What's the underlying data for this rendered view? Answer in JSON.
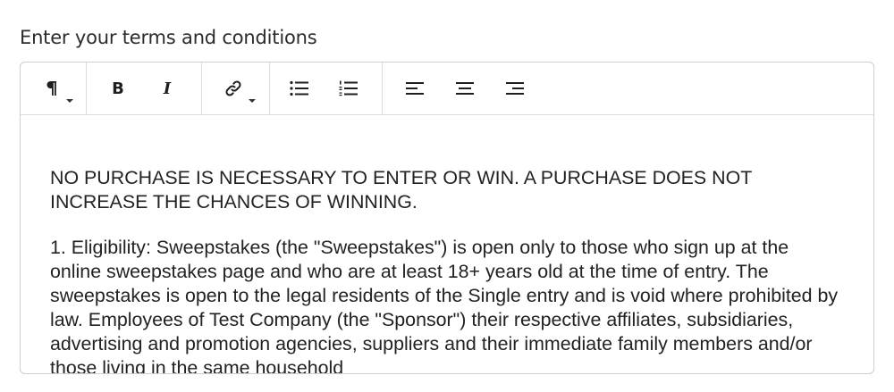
{
  "field": {
    "label": "Enter your terms and conditions"
  },
  "toolbar": {
    "paragraph_icon": "paragraph-icon",
    "bold_label": "B",
    "italic_label": "I",
    "link_icon": "link-icon",
    "bullet_list_icon": "bullet-list-icon",
    "numbered_list_icon": "numbered-list-icon",
    "align_left_icon": "align-left-icon",
    "align_center_icon": "align-center-icon",
    "align_right_icon": "align-right-icon"
  },
  "content": {
    "paragraphs": [
      "NO PURCHASE IS NECESSARY TO ENTER OR WIN. A PURCHASE DOES NOT INCREASE THE CHANCES OF WINNING.",
      "1. Eligibility: Sweepstakes (the \"Sweepstakes\") is open only to those who sign up at the online sweepstakes page and who are at least 18+ years old at the time of entry. The sweepstakes is open to the legal residents of the Single entry and is void where prohibited by law. Employees of Test Company (the \"Sponsor\") their respective affiliates, subsidiaries, advertising and promotion agencies, suppliers and their immediate family members and/or those living in the same household"
    ]
  }
}
